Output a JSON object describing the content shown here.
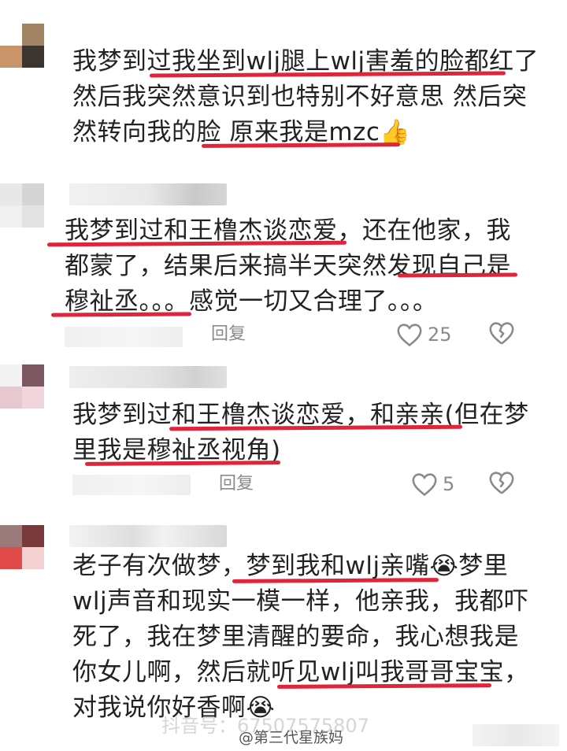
{
  "comments": [
    {
      "lines": [
        "我梦到过我坐到wlj腿上wlj害羞的脸都红了",
        "然后我突然意识到也特别不好意思 然后突",
        "然转向我的脸 原来我是mzc👍"
      ]
    },
    {
      "lines": [
        "我梦到过和王橹杰谈恋爱，还在他家，我",
        "都蒙了，结果后来搞半天突然发现自己是",
        "穆祉丞。。。感觉一切又合理了。。。"
      ],
      "reply_label": "回复",
      "like_count": "25"
    },
    {
      "lines": [
        "我梦到过和王橹杰谈恋爱，和亲亲(但在梦",
        "里我是穆祉丞视角)"
      ],
      "reply_label": "回复",
      "like_count": "5"
    },
    {
      "lines": [
        "老子有次做梦，梦到我和wlj亲嘴😭梦里",
        "wlj声音和现实一模一样，他亲我，我都吓",
        "死了，我在梦里清醒的要命，我心想我是",
        "你女儿啊，然后就听见wlj叫我哥哥宝宝，",
        "对我说你好香啊😭"
      ]
    }
  ],
  "watermark": {
    "douyin_text": "抖音号：67507575807",
    "weibo_text": "@第三代星族妈"
  },
  "colors": {
    "underline": "#e0243a",
    "text": "#222222",
    "meta": "#8a8a8a"
  },
  "icons": [
    "heart-icon",
    "broken-heart-icon"
  ]
}
